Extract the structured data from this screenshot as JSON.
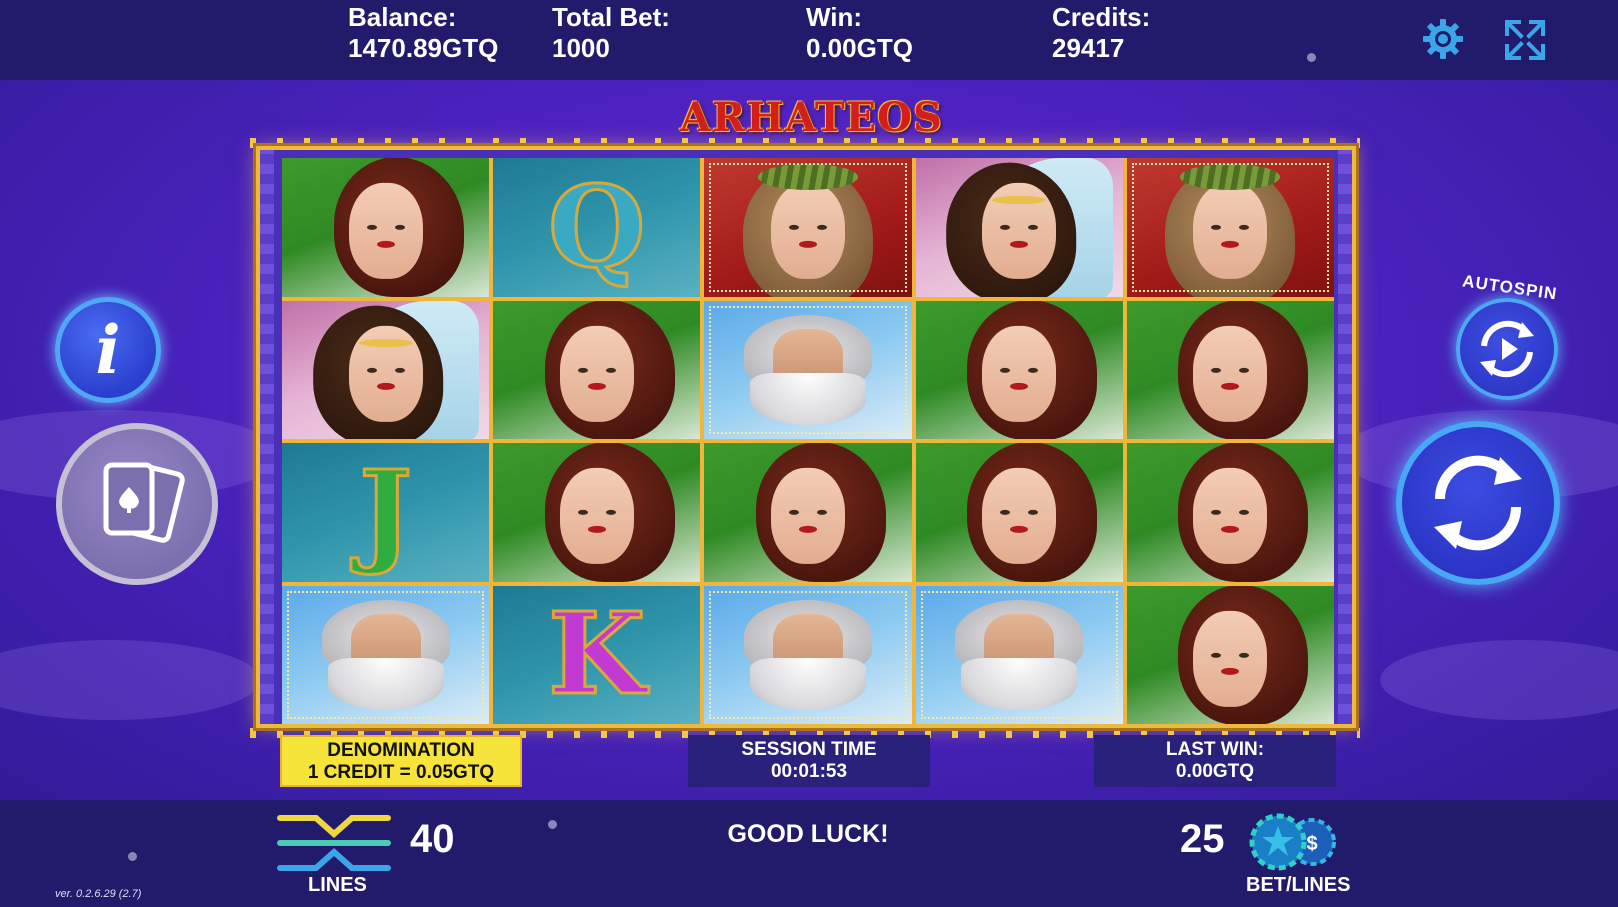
{
  "top_bar": {
    "balance": {
      "label": "Balance:",
      "value": "1470.89GTQ"
    },
    "total_bet": {
      "label": "Total Bet:",
      "value": "1000"
    },
    "win": {
      "label": "Win:",
      "value": "0.00GTQ"
    },
    "credits": {
      "label": "Credits:",
      "value": "29417"
    },
    "settings_icon": "gear-icon",
    "fullscreen_icon": "fullscreen-icon"
  },
  "game": {
    "title": "ARHATEOS",
    "reels": [
      [
        "hera",
        "queen",
        "athena",
        "veil",
        "athena"
      ],
      [
        "veil",
        "hera",
        "zeus",
        "hera",
        "hera"
      ],
      [
        "jack",
        "hera",
        "hera",
        "hera",
        "hera"
      ],
      [
        "zeus",
        "king",
        "zeus",
        "zeus",
        "hera"
      ]
    ]
  },
  "card_symbols": {
    "queen": {
      "letter": "Q",
      "color": "#39a9c4"
    },
    "jack": {
      "letter": "J",
      "color": "#2fae3f"
    },
    "king": {
      "letter": "K",
      "color": "#c23ad2"
    }
  },
  "panels": {
    "denomination": {
      "line1": "DENOMINATION",
      "line2": "1 CREDIT = 0.05GTQ"
    },
    "session": {
      "label": "SESSION TIME",
      "value": "00:01:53"
    },
    "last_win": {
      "label": "LAST WIN:",
      "value": "0.00GTQ"
    }
  },
  "controls": {
    "info_icon": "info-icon",
    "gamble_icon": "cards-icon",
    "autospin_label": "AUTOSPIN",
    "autospin_icon": "autospin-icon",
    "spin_icon": "spin-icon"
  },
  "bottom_bar": {
    "lines": {
      "value": "40",
      "label": "LINES"
    },
    "message": "GOOD LUCK!",
    "bet_lines": {
      "value": "25",
      "label": "BET/LINES"
    },
    "version": "ver. 0.2.6.29 (2.7)"
  },
  "colors": {
    "top_bar_bg": "#221a6b",
    "accent_blue": "#4ca8f2",
    "frame_gold": "#f1b93b",
    "denomination_bg": "#f7e43a"
  }
}
